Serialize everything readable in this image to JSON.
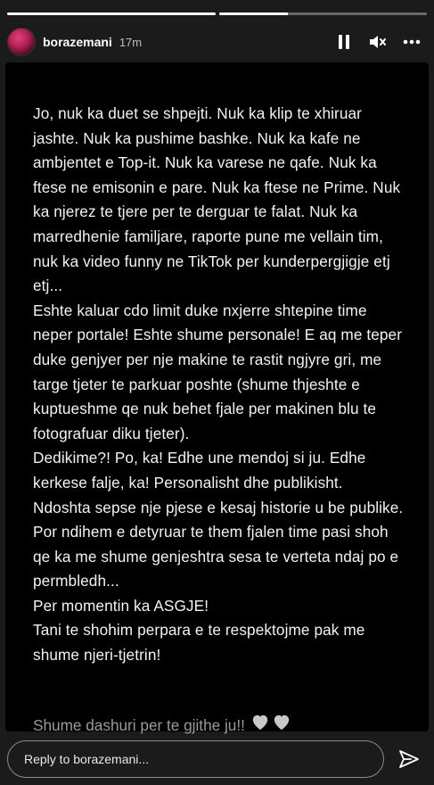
{
  "progress": [
    {
      "fill": 1.0
    },
    {
      "fill": 0.33
    }
  ],
  "header": {
    "username": "borazemani",
    "time": "17m",
    "icons": [
      "pause-icon",
      "mute-icon",
      "more-icon"
    ]
  },
  "story": {
    "paragraphs": [
      "Jo, nuk ka duet se shpejti. Nuk ka klip te xhiruar jashte. Nuk ka pushime bashke. Nuk ka kafe ne ambjentet e Top-it. Nuk ka varese ne qafe. Nuk ka ftese ne emisonin e pare. Nuk ka ftese ne Prime. Nuk ka njerez te tjere per te derguar te falat. Nuk ka marredhenie familjare, raporte pune me vellain tim, nuk ka video funny ne TikTok per kunderpergjigje etj etj...",
      "Eshte kaluar cdo limit duke nxjerre shtepine time neper portale! Eshte shume personale! E aq me teper duke genjyer per nje makine te rastit ngjyre gri, me targe tjeter te parkuar poshte (shume thjeshte e kuptueshme qe nuk behet fjale per makinen blu te fotografuar diku tjeter).",
      "Dedikime?! Po, ka! Edhe une mendoj si ju. Edhe kerkese falje, ka! Personalisht dhe publikisht.",
      "Ndoshta sepse nje pjese e kesaj historie u be publike.",
      "Por ndihem e detyruar te them fjalen time pasi shoh qe ka me shume genjeshtra sesa te verteta ndaj po e permbledh...",
      "Per momentin ka ASGJE!",
      "Tani te shohim perpara e te respektojme pak me shume njeri-tjetrin!"
    ],
    "closing": "Shume dashuri per te gjithe ju!!",
    "heart_color": "#c8c8c8"
  },
  "reply": {
    "placeholder": "Reply to borazemani..."
  }
}
